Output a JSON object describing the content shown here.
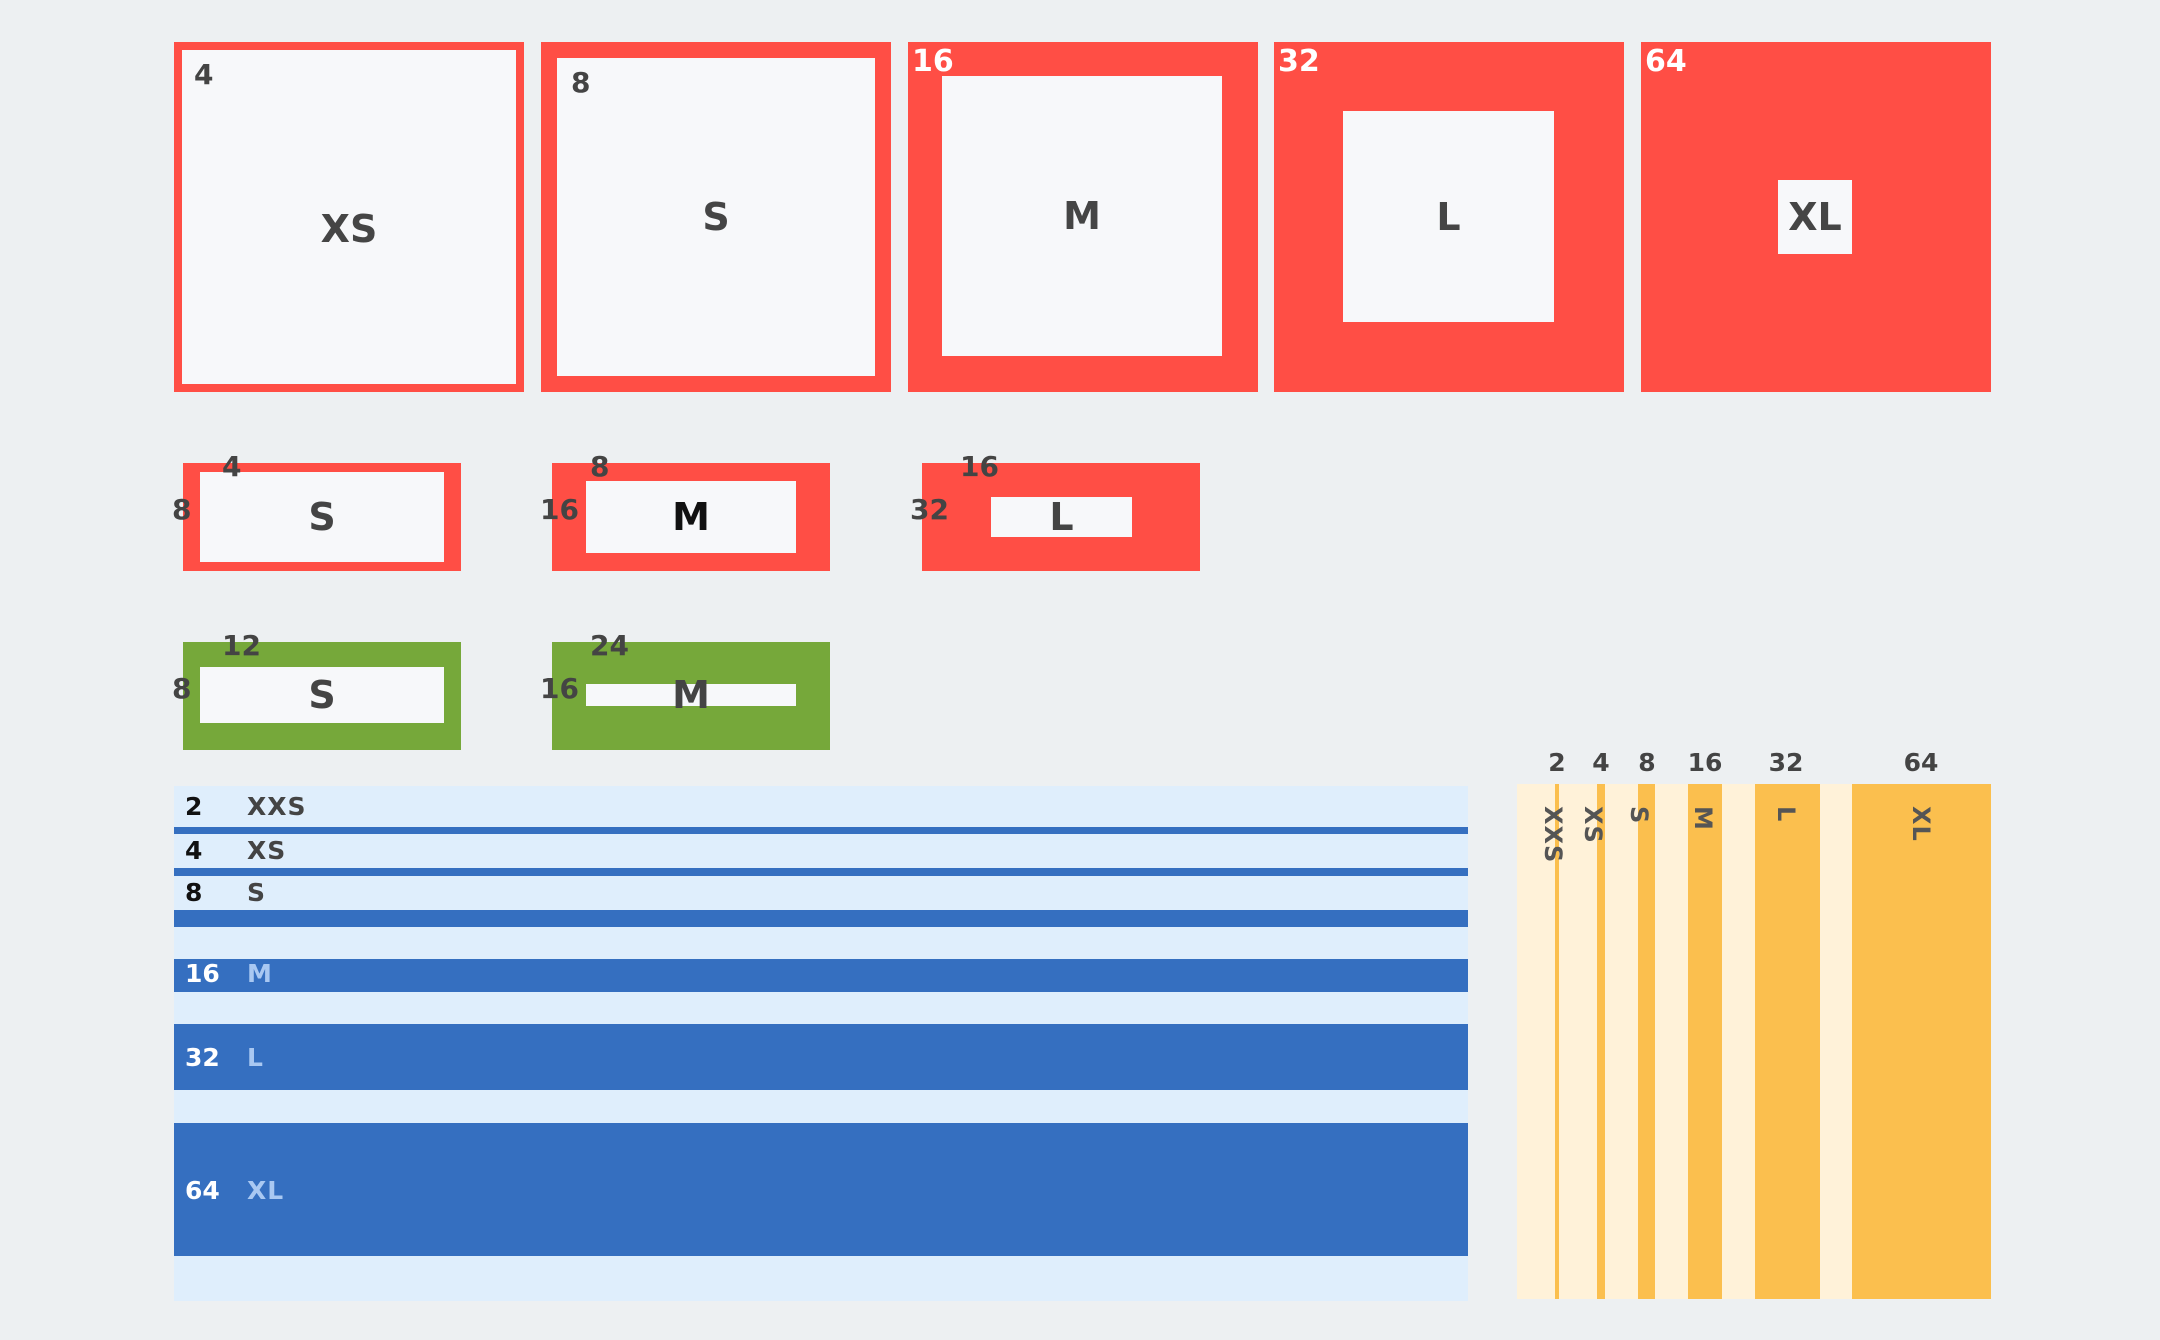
{
  "colors": {
    "background": "#edf0f2",
    "red": "#ff4e45",
    "green": "#76a83a",
    "blue": "#356fc0",
    "light_blue": "#dfeefc",
    "orange": "#fbbf4e",
    "light_orange": "#fff2d9",
    "inner": "#f7f8fa"
  },
  "square_tiles": [
    {
      "value": "4",
      "size": "XS"
    },
    {
      "value": "8",
      "size": "S"
    },
    {
      "value": "16",
      "size": "M"
    },
    {
      "value": "32",
      "size": "L"
    },
    {
      "value": "64",
      "size": "XL"
    }
  ],
  "red_row": [
    {
      "top": "4",
      "side": "8",
      "size": "S"
    },
    {
      "top": "8",
      "side": "16",
      "size": "M"
    },
    {
      "top": "16",
      "side": "32",
      "size": "L"
    }
  ],
  "green_row": [
    {
      "top": "12",
      "side": "8",
      "size": "S"
    },
    {
      "top": "24",
      "side": "16",
      "size": "M"
    }
  ],
  "horizontal_bars": [
    {
      "value": "2",
      "size": "XXS"
    },
    {
      "value": "4",
      "size": "XS"
    },
    {
      "value": "8",
      "size": "S"
    },
    {
      "value": "16",
      "size": "M"
    },
    {
      "value": "32",
      "size": "L"
    },
    {
      "value": "64",
      "size": "XL"
    }
  ],
  "vertical_bars": [
    {
      "value": "2",
      "size": "XXS"
    },
    {
      "value": "4",
      "size": "XS"
    },
    {
      "value": "8",
      "size": "S"
    },
    {
      "value": "16",
      "size": "M"
    },
    {
      "value": "32",
      "size": "L"
    },
    {
      "value": "64",
      "size": "XL"
    }
  ]
}
